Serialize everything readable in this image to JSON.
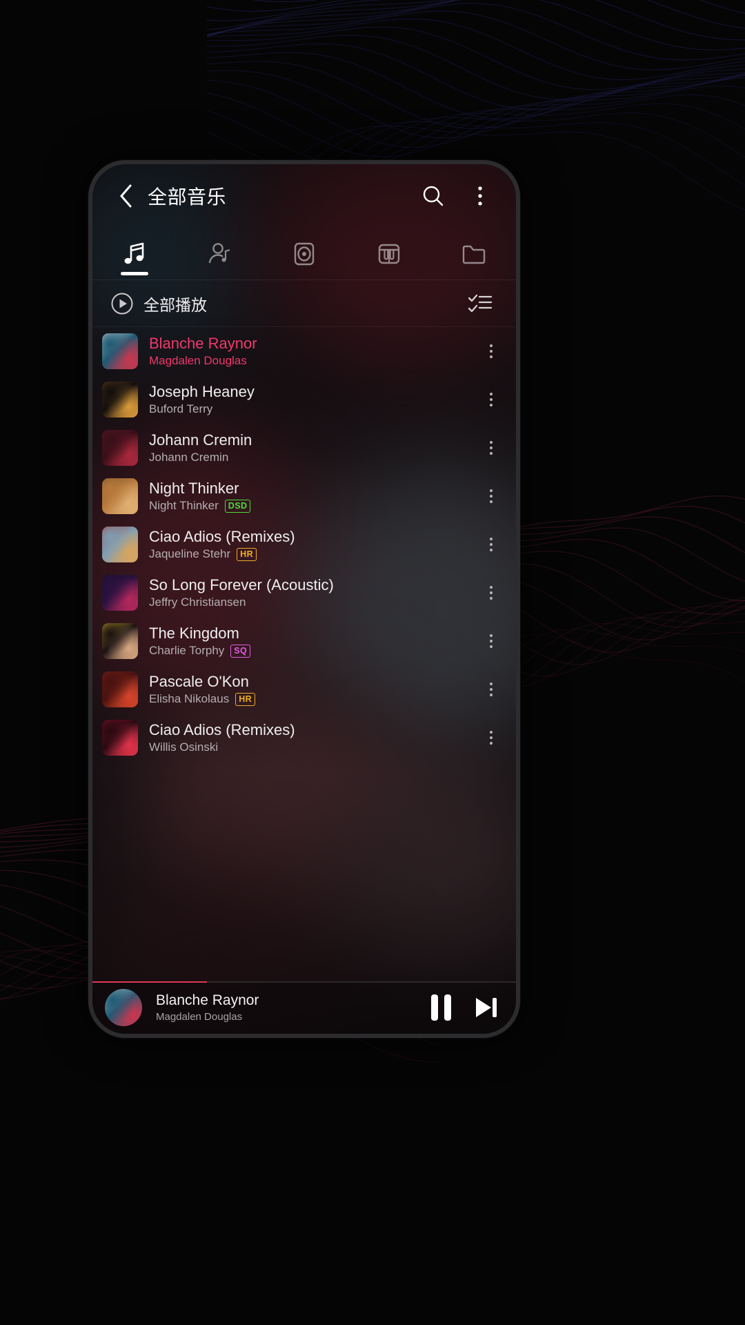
{
  "appbar": {
    "back_icon": "chevron-left-icon",
    "title": "全部音乐",
    "search_icon": "search-icon",
    "overflow_icon": "more-vertical-icon"
  },
  "tabs": [
    {
      "name": "songs",
      "icon": "music-note-icon",
      "active": true
    },
    {
      "name": "artists",
      "icon": "artist-icon",
      "active": false
    },
    {
      "name": "albums",
      "icon": "album-disc-icon",
      "active": false
    },
    {
      "name": "genres",
      "icon": "piano-keys-icon",
      "active": false
    },
    {
      "name": "folders",
      "icon": "folder-icon",
      "active": false
    }
  ],
  "playall": {
    "play_icon": "play-circle-icon",
    "label": "全部播放",
    "select_icon": "multi-select-icon"
  },
  "songs": [
    {
      "title": "Blanche Raynor",
      "artist": "Magdalen Douglas",
      "badge": "",
      "playing": true,
      "art": [
        "#1d5a74",
        "#c7374f",
        "#e8e6e4"
      ]
    },
    {
      "title": "Joseph Heaney",
      "artist": "Buford Terry",
      "badge": "",
      "playing": false,
      "art": [
        "#120d0c",
        "#d89a3a",
        "#6a4a22"
      ]
    },
    {
      "title": "Johann Cremin",
      "artist": "Johann Cremin",
      "badge": "",
      "playing": false,
      "art": [
        "#3a0f18",
        "#a8283c",
        "#5b1a2a"
      ]
    },
    {
      "title": "Night Thinker",
      "artist": "Night Thinker",
      "badge": "DSD",
      "playing": false,
      "art": [
        "#b87a3c",
        "#e0b072",
        "#6d4a26"
      ]
    },
    {
      "title": "Ciao Adios (Remixes)",
      "artist": "Jaqueline Stehr",
      "badge": "HR",
      "playing": false,
      "art": [
        "#7e9fb5",
        "#d9a45e",
        "#a0322c"
      ]
    },
    {
      "title": "So Long Forever (Acoustic)",
      "artist": "Jeffry Christiansen",
      "badge": "",
      "playing": false,
      "art": [
        "#2a1240",
        "#b5285c",
        "#14101f"
      ]
    },
    {
      "title": "The Kingdom",
      "artist": "Charlie Torphy",
      "badge": "SQ",
      "playing": false,
      "art": [
        "#1a1112",
        "#d8a882",
        "#e0c02e"
      ]
    },
    {
      "title": "Pascale O'Kon",
      "artist": "Elisha Nikolaus",
      "badge": "HR",
      "playing": false,
      "art": [
        "#4a1210",
        "#d4452a",
        "#7a2016"
      ]
    },
    {
      "title": "Ciao Adios (Remixes)",
      "artist": "Willis Osinski",
      "badge": "",
      "playing": false,
      "art": [
        "#2a0a12",
        "#e0334a",
        "#8a1426"
      ]
    }
  ],
  "miniplayer": {
    "title": "Blanche Raynor",
    "artist": "Magdalen Douglas",
    "progress_percent": 27,
    "pause_icon": "pause-icon",
    "next_icon": "skip-next-icon",
    "art": [
      "#1d5a74",
      "#c7374f",
      "#e8e6e4"
    ]
  },
  "colors": {
    "accent": "#f2386b",
    "progress": "#e0385c",
    "badge_dsd": "#4ade3a",
    "badge_hr": "#f0ae22",
    "badge_sq": "#e35ce6"
  }
}
